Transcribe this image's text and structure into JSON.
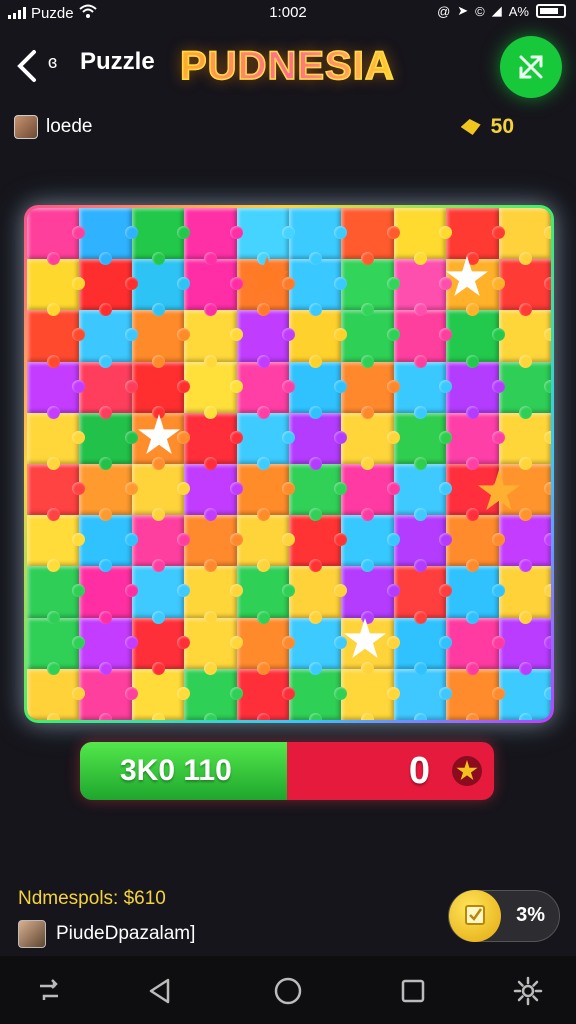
{
  "status_bar": {
    "carrier": "Puzde",
    "time": "1:002",
    "battery": "A%"
  },
  "header": {
    "back_icon": "chevron-left-icon",
    "title": "Puzzle",
    "logo": "PUDNESIA",
    "action_icon": "crossed-arrows-icon"
  },
  "user": {
    "name": "loede",
    "coins": "50"
  },
  "colors": {
    "background": "#16151b",
    "green": "#17c83b",
    "red": "#e51a3c",
    "gold": "#f4d33a"
  },
  "board": {
    "columns": 10,
    "rows": 10,
    "pieces": [
      "#ff3f9b",
      "#2fb2ff",
      "#22c84a",
      "#ff2fa6",
      "#45d4ff",
      "#3ccbff",
      "#ff5b2e",
      "#ffda2f",
      "#ff3a32",
      "#ffd23c",
      "#ffd82e",
      "#ff2e2e",
      "#2ec3f5",
      "#ff2da6",
      "#ff7b29",
      "#39c8ff",
      "#33d45a",
      "#ff4fae",
      "#ffb12a",
      "#ff3b36",
      "#ff4a2e",
      "#3cc8ff",
      "#ff8a2a",
      "#ffd93a",
      "#c03cff",
      "#ffd12c",
      "#2fd056",
      "#ff3f9e",
      "#23c94c",
      "#ffd63a",
      "#c33cff",
      "#ff3e5e",
      "#ff2f2f",
      "#ffe03a",
      "#ff3fa5",
      "#2fc2ff",
      "#ff882d",
      "#3ac9ff",
      "#b33cff",
      "#2fcf57",
      "#ffd73a",
      "#22c24a",
      "#ff8d2b",
      "#ff2e3a",
      "#3ecbff",
      "#b33cff",
      "#ffd53a",
      "#2fce4f",
      "#ff3fa8",
      "#ffd63a",
      "#ff4242",
      "#ff9a2e",
      "#ffd33a",
      "#c23cff",
      "#ff8c29",
      "#31d057",
      "#ff3aa3",
      "#3fcaff",
      "#ff2f3e",
      "#ff942c",
      "#ffdc3a",
      "#2fc2ff",
      "#ff3fa0",
      "#ff8a2e",
      "#ffd43a",
      "#ff3333",
      "#37c8ff",
      "#b33cff",
      "#ff8b2c",
      "#c43cff",
      "#2fcf57",
      "#ff2fa3",
      "#3ec9ff",
      "#ffd63a",
      "#2fd056",
      "#ffd23a",
      "#b33cff",
      "#ff3e3e",
      "#2fc2ff",
      "#ffd23a",
      "#2fd055",
      "#c33cff",
      "#ff2f3a",
      "#ffd73a",
      "#ff8a2c",
      "#3ccaff",
      "#ffd43a",
      "#2fc2ff",
      "#ff3aa0",
      "#b93cff",
      "#ffd23a",
      "#ff3f9e",
      "#ffdc3a",
      "#2fd056",
      "#ff2f3a",
      "#2fd056",
      "#ffd73a",
      "#3ec8ff",
      "#ff8b2c",
      "#3ccaff"
    ]
  },
  "progress": {
    "left_label": "3K0 110",
    "right_label": "0",
    "fill_fraction": 0.5,
    "icon": "star-badge-icon"
  },
  "footer": {
    "stats_text": "Ndmespols: $610",
    "player_name": "PiudeDpazalam]",
    "reward_label": "3%"
  },
  "nav": {
    "icons": [
      "sync-icon",
      "back-triangle-icon",
      "home-circle-icon",
      "recents-square-icon",
      "settings-gear-icon"
    ]
  }
}
